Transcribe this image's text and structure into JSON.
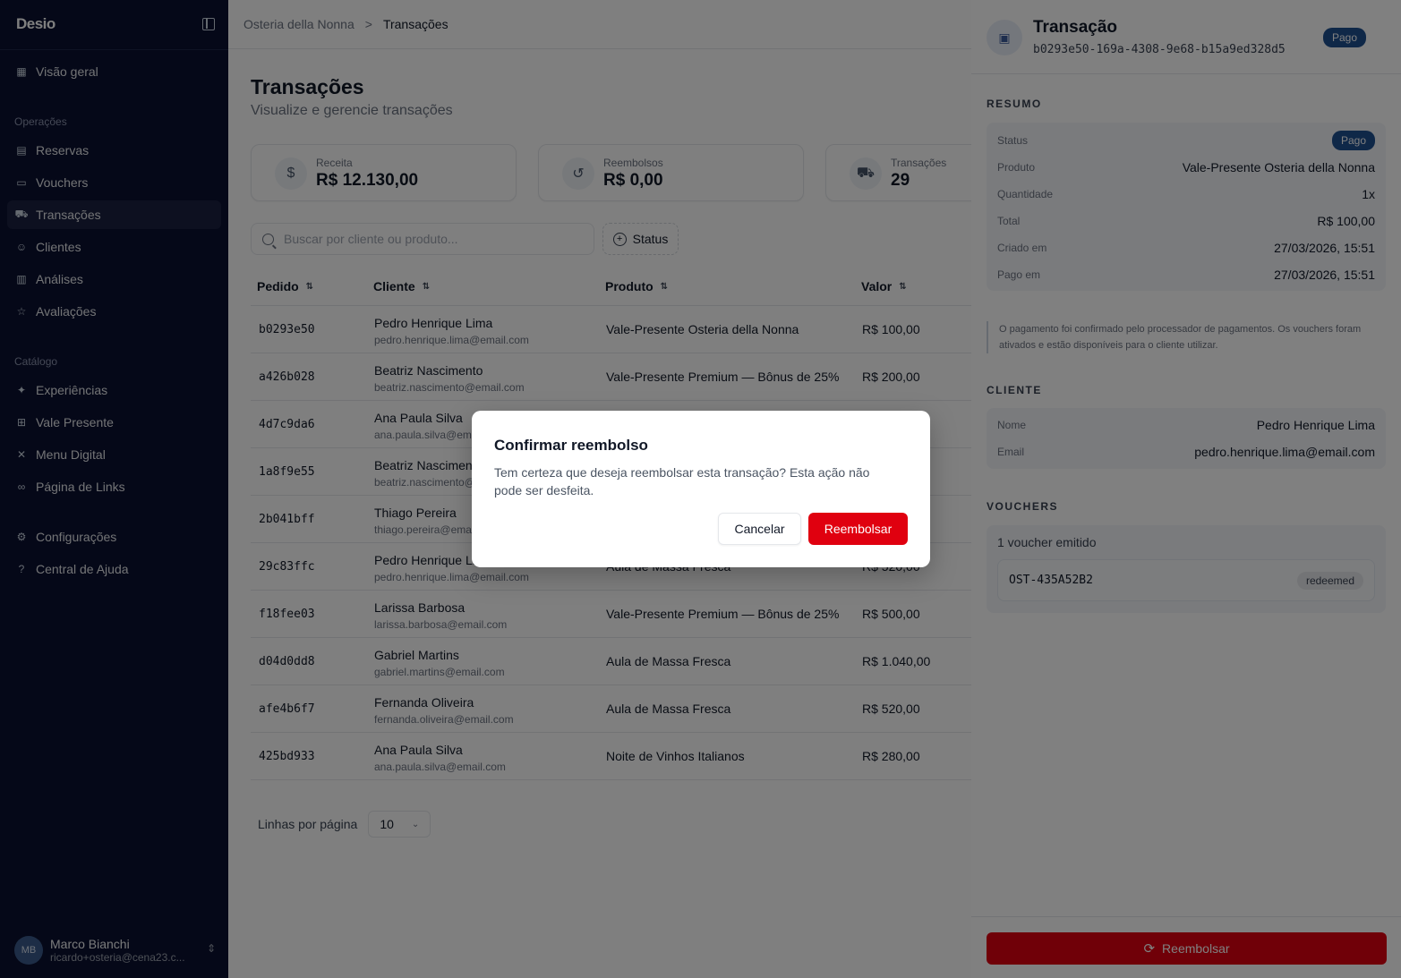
{
  "app": {
    "logo": "Desio"
  },
  "sidebar": {
    "top_item": {
      "label": "Visão geral",
      "icon": "dashboard-icon"
    },
    "section_operations": "Operações",
    "operations": [
      {
        "label": "Reservas",
        "icon": "calendar-icon"
      },
      {
        "label": "Vouchers",
        "icon": "ticket-icon"
      },
      {
        "label": "Transações",
        "icon": "cart-icon",
        "active": true
      },
      {
        "label": "Clientes",
        "icon": "users-icon"
      },
      {
        "label": "Análises",
        "icon": "chart-icon"
      },
      {
        "label": "Avaliações",
        "icon": "star-icon"
      }
    ],
    "section_catalog": "Catálogo",
    "catalog": [
      {
        "label": "Experiências",
        "icon": "sparkle-icon"
      },
      {
        "label": "Vale Presente",
        "icon": "gift-icon"
      },
      {
        "label": "Menu Digital",
        "icon": "utensils-icon"
      },
      {
        "label": "Página de Links",
        "icon": "link-icon"
      }
    ],
    "bottom": [
      {
        "label": "Configurações",
        "icon": "gear-icon"
      },
      {
        "label": "Central de Ajuda",
        "icon": "help-icon"
      }
    ],
    "user": {
      "initials": "MB",
      "name": "Marco Bianchi",
      "email": "ricardo+osteria@cena23.c..."
    }
  },
  "breadcrumb": {
    "parent": "Osteria della Nonna",
    "separator": ">",
    "current": "Transações"
  },
  "page": {
    "title": "Transações",
    "subtitle": "Visualize e gerencie transações"
  },
  "stats": [
    {
      "label": "Receita",
      "value": "R$ 12.130,00",
      "icon": "$"
    },
    {
      "label": "Reembolsos",
      "value": "R$ 0,00",
      "icon": "↺"
    },
    {
      "label": "Transações",
      "value": "29",
      "icon": "cart"
    }
  ],
  "filters": {
    "search_placeholder": "Buscar por cliente ou produto...",
    "status_label": "Status"
  },
  "table": {
    "columns": [
      "Pedido",
      "Cliente",
      "Produto",
      "Valor"
    ],
    "rows": [
      {
        "id": "b0293e50",
        "name": "Pedro Henrique Lima",
        "email": "pedro.henrique.lima@email.com",
        "product": "Vale-Presente Osteria della Nonna",
        "value": "R$ 100,00"
      },
      {
        "id": "a426b028",
        "name": "Beatriz Nascimento",
        "email": "beatriz.nascimento@email.com",
        "product": "Vale-Presente Premium — Bônus de 25%",
        "value": "R$ 200,00"
      },
      {
        "id": "4d7c9da6",
        "name": "Ana Paula Silva",
        "email": "ana.paula.silva@email.com",
        "product": "",
        "value": ""
      },
      {
        "id": "1a8f9e55",
        "name": "Beatriz Nascimento",
        "email": "beatriz.nascimento@email.com",
        "product": "",
        "value": ""
      },
      {
        "id": "2b041bff",
        "name": "Thiago Pereira",
        "email": "thiago.pereira@email.com",
        "product": "",
        "value": ""
      },
      {
        "id": "29c83ffc",
        "name": "Pedro Henrique Lima",
        "email": "pedro.henrique.lima@email.com",
        "product": "Aula de Massa Fresca",
        "value": "R$ 520,00"
      },
      {
        "id": "f18fee03",
        "name": "Larissa Barbosa",
        "email": "larissa.barbosa@email.com",
        "product": "Vale-Presente Premium — Bônus de 25%",
        "value": "R$ 500,00"
      },
      {
        "id": "d04d0dd8",
        "name": "Gabriel Martins",
        "email": "gabriel.martins@email.com",
        "product": "Aula de Massa Fresca",
        "value": "R$ 1.040,00"
      },
      {
        "id": "afe4b6f7",
        "name": "Fernanda Oliveira",
        "email": "fernanda.oliveira@email.com",
        "product": "Aula de Massa Fresca",
        "value": "R$ 520,00"
      },
      {
        "id": "425bd933",
        "name": "Ana Paula Silva",
        "email": "ana.paula.silva@email.com",
        "product": "Noite de Vinhos Italianos",
        "value": "R$ 280,00"
      }
    ]
  },
  "pagination": {
    "rows_label": "Linhas por página",
    "rows_value": "10"
  },
  "panel": {
    "title": "Transação",
    "transaction_id": "b0293e50-169a-4308-9e68-b15a9ed328d5",
    "status_badge": "Pago",
    "summary_label": "RESUMO",
    "summary": [
      {
        "key": "Status",
        "value": "Pago",
        "badge": true
      },
      {
        "key": "Produto",
        "value": "Vale-Presente Osteria della Nonna"
      },
      {
        "key": "Quantidade",
        "value": "1x"
      },
      {
        "key": "Total",
        "value": "R$ 100,00"
      },
      {
        "key": "Criado em",
        "value": "27/03/2026, 15:51"
      },
      {
        "key": "Pago em",
        "value": "27/03/2026, 15:51"
      }
    ],
    "note": "O pagamento foi confirmado pelo processador de pagamentos. Os vouchers foram ativados e estão disponíveis para o cliente utilizar.",
    "client_label": "CLIENTE",
    "client": [
      {
        "key": "Nome",
        "value": "Pedro Henrique Lima"
      },
      {
        "key": "Email",
        "value": "pedro.henrique.lima@email.com"
      }
    ],
    "vouchers_label": "VOUCHERS",
    "vouchers_count": "1 voucher emitido",
    "voucher": {
      "code": "OST-435A52B2",
      "status": "redeemed"
    },
    "refund_button": "Reembolsar"
  },
  "modal": {
    "title": "Confirmar reembolso",
    "text": "Tem certeza que deseja reembolsar esta transação? Esta ação não pode ser desfeita.",
    "cancel": "Cancelar",
    "confirm": "Reembolsar"
  },
  "colors": {
    "sidebar_bg": "#0a1030",
    "danger": "#e0000f",
    "badge_paid": "#1d4f91"
  }
}
